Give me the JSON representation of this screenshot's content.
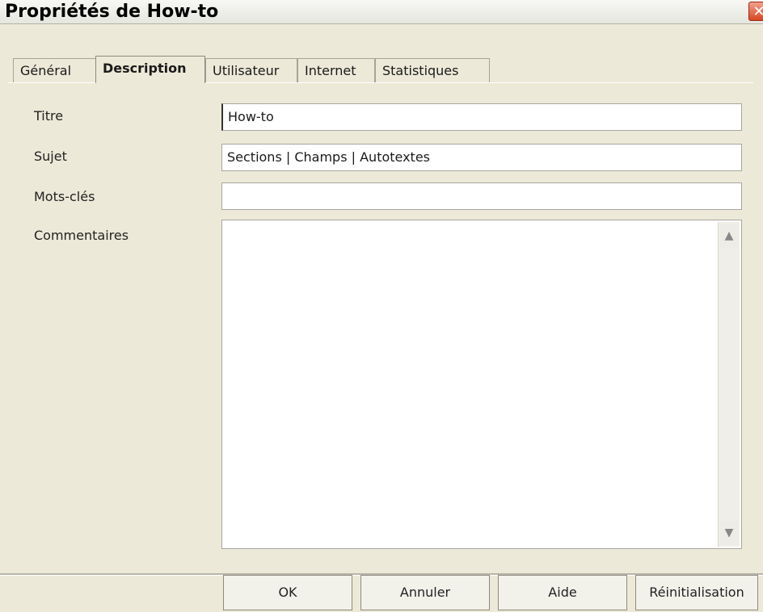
{
  "window": {
    "title": "Propriétés de How-to",
    "close_glyph": "✕"
  },
  "tabs": [
    {
      "label": "Général"
    },
    {
      "label": "Description"
    },
    {
      "label": "Utilisateur"
    },
    {
      "label": "Internet"
    },
    {
      "label": "Statistiques"
    }
  ],
  "form": {
    "title_label": "Titre",
    "title_value": "How-to",
    "subject_label": "Sujet",
    "subject_value": "Sections | Champs | Autotextes",
    "keywords_label": "Mots-clés",
    "keywords_value": "",
    "comments_label": "Commentaires",
    "comments_value": ""
  },
  "scrollbar": {
    "up_glyph": "▲",
    "down_glyph": "▼"
  },
  "buttons": {
    "ok": "OK",
    "cancel": "Annuler",
    "help": "Aide",
    "reset": "Réinitialisation"
  }
}
